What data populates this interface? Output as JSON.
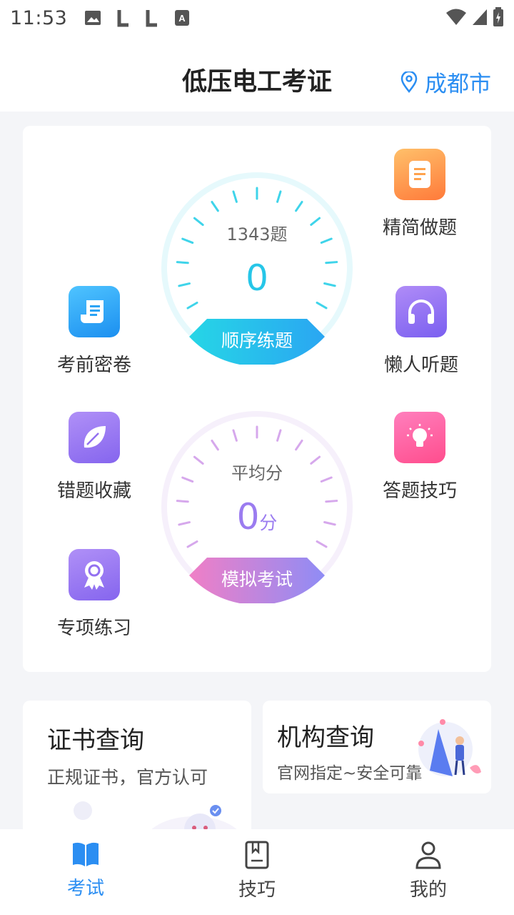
{
  "status": {
    "time": "11:53",
    "icons": [
      "image-icon",
      "l-icon",
      "l-icon",
      "a-icon"
    ],
    "right_icons": [
      "wifi-icon",
      "signal-icon",
      "battery-icon"
    ]
  },
  "header": {
    "title": "低压电工考证",
    "city": "成都市",
    "city_icon": "location-pin-icon"
  },
  "practice_gauge": {
    "count": "1343题",
    "value": "0",
    "button": "顺序练题",
    "accent": "#26c6e8"
  },
  "exam_gauge": {
    "label": "平均分",
    "value": "0",
    "unit": "分",
    "button": "模拟考试",
    "accent": "#9b7cf0"
  },
  "features": [
    {
      "label": "精简做题",
      "icon": "note-icon",
      "color": "#ff8a3d"
    },
    {
      "label": "考前密卷",
      "icon": "scroll-icon",
      "color": "#2ba3f5"
    },
    {
      "label": "懒人听题",
      "icon": "headphones-icon",
      "color": "#8f6cf0"
    },
    {
      "label": "错题收藏",
      "icon": "leaf-icon",
      "color": "#9370f0"
    },
    {
      "label": "答题技巧",
      "icon": "lightbulb-icon",
      "color": "#ff5f9e"
    },
    {
      "label": "专项练习",
      "icon": "medal-icon",
      "color": "#9370f0"
    }
  ],
  "cert_card": {
    "title": "证书查询",
    "desc": "正规证书，官方认可"
  },
  "org_card": {
    "title": "机构查询",
    "desc": "官网指定~安全可靠"
  },
  "tabs": [
    {
      "label": "考试",
      "icon": "book-icon",
      "active": true
    },
    {
      "label": "技巧",
      "icon": "bookmark-book-icon",
      "active": false
    },
    {
      "label": "我的",
      "icon": "user-icon",
      "active": false
    }
  ]
}
